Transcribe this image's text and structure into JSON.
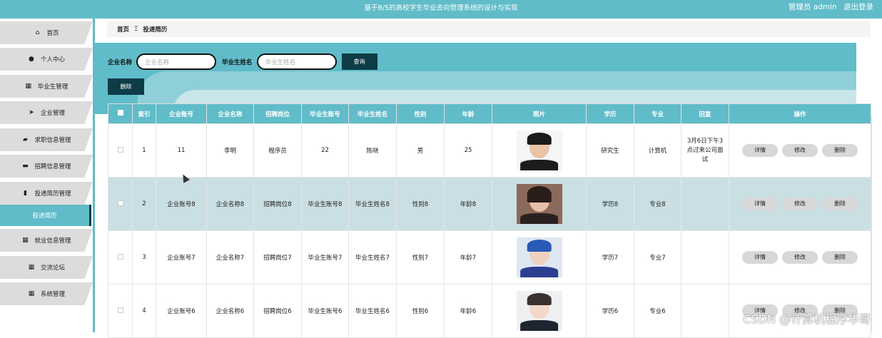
{
  "header": {
    "title": "基于B/S的高校学生毕业去向管理系统的设计与实现",
    "user": "管理员 admin",
    "logout": "退出登录"
  },
  "sidebar": {
    "items": [
      {
        "label": "首页",
        "icon": "home-icon",
        "glyph": "⌂"
      },
      {
        "label": "个人中心",
        "icon": "user-icon",
        "glyph": "●"
      },
      {
        "label": "毕业生管理",
        "icon": "grid-icon",
        "glyph": "▦"
      },
      {
        "label": "企业管理",
        "icon": "send-icon",
        "glyph": "➤"
      },
      {
        "label": "求职信息管理",
        "icon": "thumb-icon",
        "glyph": "▰"
      },
      {
        "label": "招聘信息管理",
        "icon": "briefcase-icon",
        "glyph": "▬"
      },
      {
        "label": "投递简历管理",
        "icon": "bar-chart-icon",
        "glyph": "▮"
      },
      {
        "label": "投递简历",
        "icon": "",
        "glyph": ""
      },
      {
        "label": "就业信息管理",
        "icon": "grid-icon",
        "glyph": "▦"
      },
      {
        "label": "交流论坛",
        "icon": "grid-icon",
        "glyph": "▦"
      },
      {
        "label": "系统管理",
        "icon": "grid-icon",
        "glyph": "▦"
      }
    ],
    "active_index": 7
  },
  "breadcrumb": {
    "home": "首页",
    "sep": "Ξ",
    "current": "投递简历"
  },
  "search": {
    "company_label": "企业名称",
    "company_placeholder": "企业名称",
    "grad_label": "毕业生姓名",
    "grad_placeholder": "毕业生姓名",
    "query_button": "查询"
  },
  "toolbar": {
    "delete_label": "删除"
  },
  "table": {
    "headers": [
      "",
      "索引",
      "企业账号",
      "企业名称",
      "招聘岗位",
      "毕业生账号",
      "毕业生姓名",
      "性别",
      "年龄",
      "照片",
      "学历",
      "专业",
      "回复",
      "操作"
    ],
    "rows": [
      {
        "index": "1",
        "company_account": "11",
        "company_name": "李明",
        "position": "程序员",
        "grad_account": "22",
        "grad_name": "陈晓",
        "gender": "男",
        "age": "25",
        "education": "研究生",
        "major": "计算机",
        "reply": "3月6日下午3点过来公司面试"
      },
      {
        "index": "2",
        "company_account": "企业账号8",
        "company_name": "企业名称8",
        "position": "招聘岗位8",
        "grad_account": "毕业生账号8",
        "grad_name": "毕业生姓名8",
        "gender": "性别8",
        "age": "年龄8",
        "education": "学历8",
        "major": "专业8",
        "reply": ""
      },
      {
        "index": "3",
        "company_account": "企业账号7",
        "company_name": "企业名称7",
        "position": "招聘岗位7",
        "grad_account": "毕业生账号7",
        "grad_name": "毕业生姓名7",
        "gender": "性别7",
        "age": "年龄7",
        "education": "学历7",
        "major": "专业7",
        "reply": ""
      },
      {
        "index": "4",
        "company_account": "企业账号6",
        "company_name": "企业名称6",
        "position": "招聘岗位6",
        "grad_account": "毕业生账号6",
        "grad_name": "毕业生姓名6",
        "gender": "性别6",
        "age": "年龄6",
        "education": "学历6",
        "major": "专业6",
        "reply": ""
      }
    ],
    "actions": {
      "detail": "详情",
      "edit": "修改",
      "delete": "删除"
    }
  },
  "watermark": "CSDN @计算机程序华哥",
  "colors": {
    "accent": "#5fbcc8",
    "dark": "#0e3c46",
    "highlight_row": "#c9dfe3"
  }
}
